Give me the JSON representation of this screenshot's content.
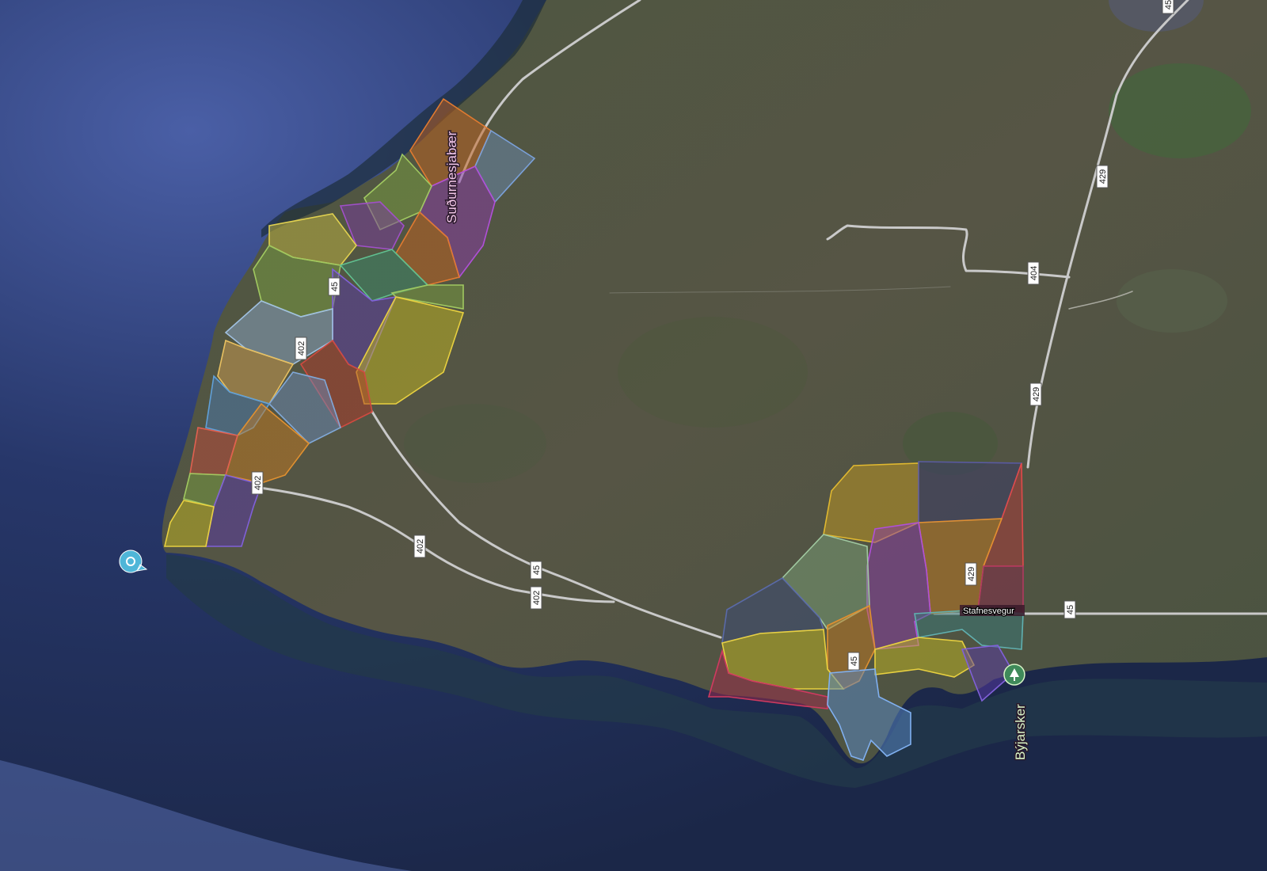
{
  "map": {
    "view": "satellite",
    "colors": {
      "sea": "#1f2d52",
      "sea_far": "#4a5fa6",
      "land": "#4a4f3a",
      "road": "#c9c9c9"
    }
  },
  "places": [
    {
      "id": "sudurnesjabaer",
      "label": "Suðurnesjabær",
      "color": "#f2c6e8"
    },
    {
      "id": "byjarsker",
      "label": "Býjarsker",
      "color": "#d8f5c8"
    }
  ],
  "street": {
    "label": "Stafnesvegur"
  },
  "road_shields": [
    {
      "id": "r45a",
      "label": "45"
    },
    {
      "id": "r402a",
      "label": "402"
    },
    {
      "id": "r402b",
      "label": "402"
    },
    {
      "id": "r402c",
      "label": "402"
    },
    {
      "id": "r402d",
      "label": "402"
    },
    {
      "id": "r45b",
      "label": "45"
    },
    {
      "id": "r45c",
      "label": "45"
    },
    {
      "id": "r45d",
      "label": "45"
    },
    {
      "id": "r429a",
      "label": "429"
    },
    {
      "id": "r429b",
      "label": "429"
    },
    {
      "id": "r429c",
      "label": "429"
    },
    {
      "id": "r404",
      "label": "404"
    },
    {
      "id": "r45e",
      "label": "45"
    }
  ],
  "markers": [
    {
      "id": "marker-left",
      "icon": "sight-icon",
      "color": "#4fb6d8"
    },
    {
      "id": "marker-byjarsker",
      "icon": "park-icon",
      "color": "#3f8a5a"
    }
  ]
}
